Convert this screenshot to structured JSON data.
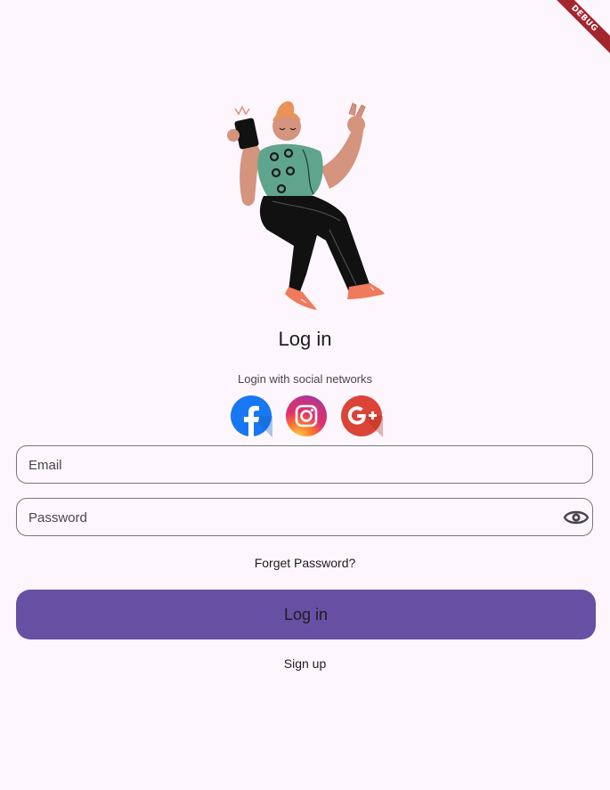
{
  "banner": {
    "label": "DEBUG"
  },
  "header": {
    "title": "Log in",
    "subtitle": "Login with social networks"
  },
  "social": {
    "items": [
      {
        "name": "facebook",
        "icon": "facebook-icon",
        "color": "#1877f2"
      },
      {
        "name": "instagram",
        "icon": "instagram-icon",
        "color": "#d62976"
      },
      {
        "name": "google",
        "icon": "google-plus-icon",
        "color": "#db4437"
      }
    ]
  },
  "form": {
    "email": {
      "placeholder": "Email",
      "value": ""
    },
    "password": {
      "placeholder": "Password",
      "value": "",
      "toggle_icon": "eye-icon"
    },
    "forgot_label": "Forget Password?",
    "login_label": "Log in",
    "signup_label": "Sign up"
  },
  "colors": {
    "background": "#fdf7fd",
    "primary": "#6750a4",
    "outline": "#79747e",
    "banner": "#a3262f"
  }
}
